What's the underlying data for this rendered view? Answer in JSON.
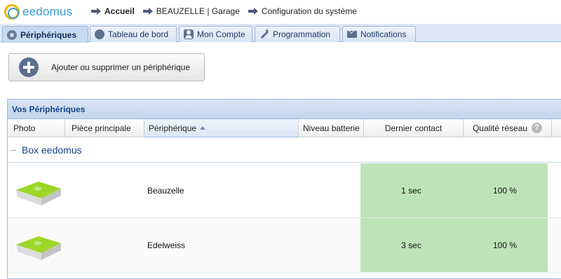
{
  "app": {
    "logo_text": "eedomus"
  },
  "breadcrumbs": [
    {
      "label": "Accueil"
    },
    {
      "label": "BEAUZELLE | Garage"
    },
    {
      "label": "Configuration du système"
    }
  ],
  "tabs": [
    {
      "label": "Périphériques",
      "icon": "gear-icon",
      "active": true
    },
    {
      "label": "Tableau de bord",
      "icon": "gauge-icon"
    },
    {
      "label": "Mon Compte",
      "icon": "user-icon"
    },
    {
      "label": "Programmation",
      "icon": "wand-icon"
    },
    {
      "label": "Notifications",
      "icon": "mail-icon"
    }
  ],
  "add_button": {
    "label": "Ajouter ou supprimer un périphérique",
    "icon": "plus-icon"
  },
  "panel": {
    "title": "Vos Périphériques",
    "columns": [
      "Photo",
      "Pièce principale",
      "Périphérique",
      "Niveau batterie",
      "Dernier contact",
      "Qualité réseau"
    ],
    "sorted_column": "Périphérique",
    "sort_direction": "ascending",
    "group": {
      "label": "Box eedomus"
    },
    "rows": [
      {
        "photo": "eedomus-box-image",
        "room": "",
        "device": "Beauzelle",
        "battery": "",
        "last_contact": "1 sec",
        "network_quality": "100 %"
      },
      {
        "photo": "eedomus-box-image",
        "room": "",
        "device": "Edelweiss",
        "battery": "",
        "last_contact": "3 sec",
        "network_quality": "100 %"
      }
    ]
  },
  "colors": {
    "accent": "#15428b",
    "status_ok": "#bfe3b9",
    "box_green": "#9ed628"
  }
}
